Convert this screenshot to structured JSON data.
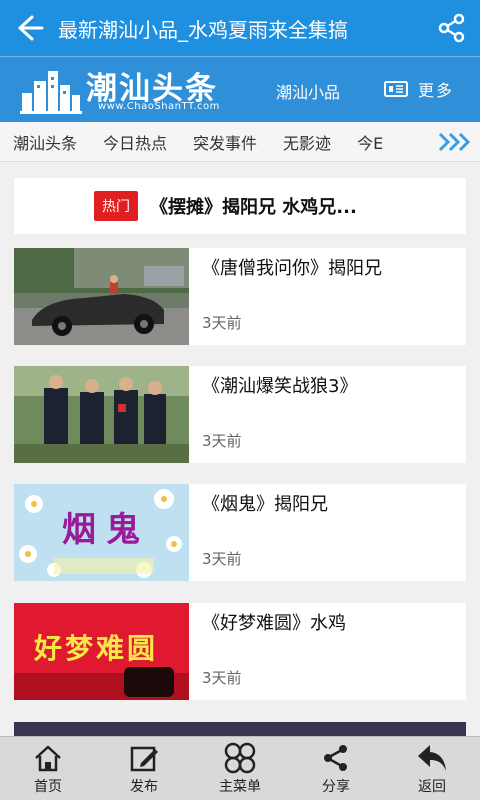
{
  "header": {
    "title": "最新潮汕小品_水鸡夏雨来全集搞",
    "back_icon": "back-arrow-icon",
    "share_icon": "share-icon"
  },
  "brand": {
    "logo_text": "潮汕头条",
    "logo_url": "www.ChaoShanTT.com",
    "subtitle": "潮汕小品",
    "more_label": "更多",
    "more_icon": "list-icon"
  },
  "tabs": [
    "潮汕头条",
    "今日热点",
    "突发事件",
    "无影迹",
    "今E"
  ],
  "hot": {
    "badge": "热门",
    "title": "《摆摊》揭阳兄 水鸡兄..."
  },
  "articles": [
    {
      "title": "《唐僧我问你》揭阳兄",
      "time": "3天前"
    },
    {
      "title": "《潮汕爆笑战狼3》",
      "time": "3天前"
    },
    {
      "title": "《烟鬼》揭阳兄",
      "time": "3天前",
      "thumb_text": "烟鬼"
    },
    {
      "title": "《好梦难圆》水鸡",
      "time": "3天前",
      "thumb_text": "好梦难圆"
    }
  ],
  "bottom_nav": [
    {
      "label": "首页",
      "icon": "home-icon"
    },
    {
      "label": "发布",
      "icon": "edit-icon"
    },
    {
      "label": "主菜单",
      "icon": "menu-grid-icon"
    },
    {
      "label": "分享",
      "icon": "share-icon"
    },
    {
      "label": "返回",
      "icon": "return-icon"
    }
  ],
  "colors": {
    "primary": "#1f8fe0",
    "hot_badge": "#e02020",
    "nav_bg": "#d9d9d9"
  }
}
